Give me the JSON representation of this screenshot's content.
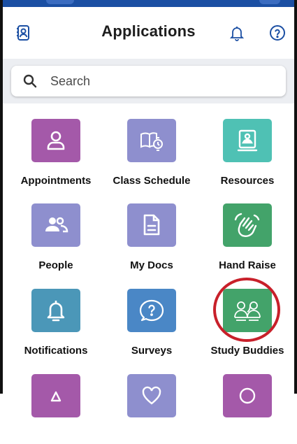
{
  "header": {
    "title": "Applications",
    "left_icon": "contacts-book-icon",
    "bell_icon": "bell-icon",
    "help_icon": "help-circle-icon"
  },
  "search": {
    "placeholder": "Search",
    "value": ""
  },
  "apps": [
    {
      "label": "Appointments",
      "icon": "person-icon",
      "color": "#a459a9"
    },
    {
      "label": "Class Schedule",
      "icon": "book-clock-icon",
      "color": "#8e8fce"
    },
    {
      "label": "Resources",
      "icon": "resources-monitor-icon",
      "color": "#4fc1b4"
    },
    {
      "label": "People",
      "icon": "people-icon",
      "color": "#8e8fce"
    },
    {
      "label": "My Docs",
      "icon": "document-icon",
      "color": "#8e8fce"
    },
    {
      "label": "Hand Raise",
      "icon": "hand-raise-icon",
      "color": "#43a36a"
    },
    {
      "label": "Notifications",
      "icon": "bell-icon",
      "color": "#4b97b8"
    },
    {
      "label": "Surveys",
      "icon": "chat-question-icon",
      "color": "#4a87c6"
    },
    {
      "label": "Study Buddies",
      "icon": "study-buddies-icon",
      "color": "#43a36a"
    },
    {
      "label": "",
      "icon": "partial-icon",
      "color": "#a459a9"
    },
    {
      "label": "",
      "icon": "partial-icon",
      "color": "#8e8fce"
    },
    {
      "label": "",
      "icon": "partial-icon",
      "color": "#a459a9"
    }
  ],
  "colors": {
    "status_bar": "#1b4fa3",
    "accent": "#1b4fa3",
    "highlight_circle": "#c8202a",
    "search_bg": "#eceef2"
  }
}
